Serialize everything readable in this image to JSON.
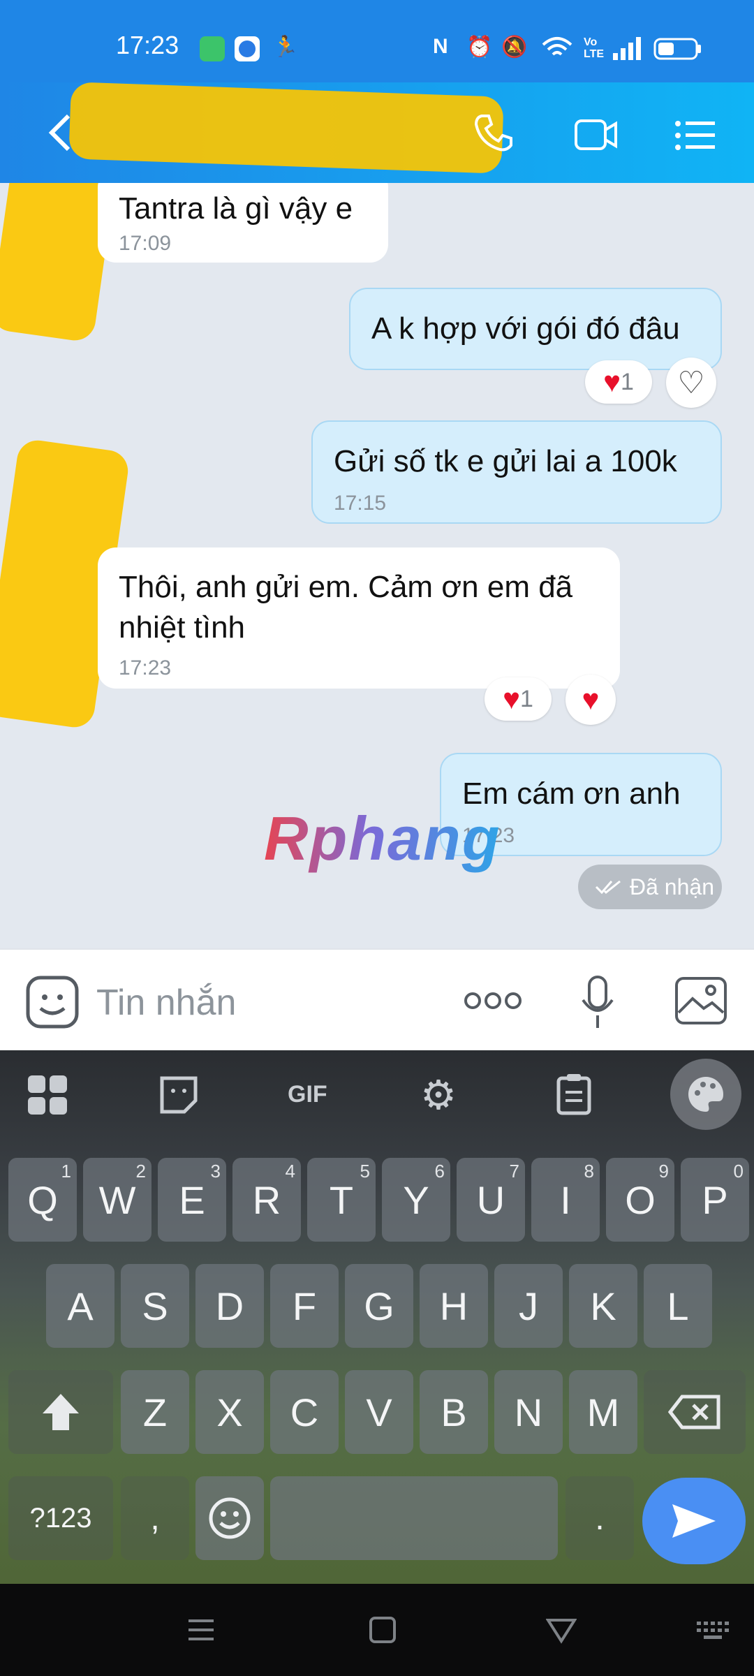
{
  "status_bar": {
    "time": "17:23",
    "icons": [
      "battery-saver-icon",
      "app-icon",
      "running-icon",
      "nfc-icon",
      "alarm-icon",
      "mute-icon",
      "wifi-icon",
      "volte-icon",
      "signal-icon",
      "battery-icon"
    ],
    "volte_label": "Vo LTE"
  },
  "header": {
    "icons": [
      "back-icon",
      "phone-icon",
      "video-call-icon",
      "menu-list-icon"
    ]
  },
  "messages": [
    {
      "direction": "in",
      "text": "Tantra là gì vậy e",
      "time": "17:09"
    },
    {
      "direction": "out",
      "text": "A k hợp với gói đó đâu",
      "reaction_count": "1"
    },
    {
      "direction": "out",
      "text": "Gửi số tk e gửi lai a 100k",
      "time": "17:15"
    },
    {
      "direction": "in",
      "text_line1": "Thôi, anh gửi em. Cảm ơn em đã",
      "text_line2": "nhiệt tình",
      "time": "17:23",
      "reaction_count": "1"
    },
    {
      "direction": "out",
      "text": "Em cám ơn anh",
      "time": "17:23"
    }
  ],
  "delivery_status": "Đã nhận",
  "watermark": "Rphang",
  "input": {
    "placeholder": "Tin nhắn"
  },
  "keyboard": {
    "toolbar": [
      "apps-grid-icon",
      "sticker-icon",
      "GIF",
      "settings-gear-icon",
      "clipboard-icon",
      "palette-icon"
    ],
    "gif_label": "GIF",
    "row1": [
      {
        "key": "Q",
        "hint": "1"
      },
      {
        "key": "W",
        "hint": "2"
      },
      {
        "key": "E",
        "hint": "3"
      },
      {
        "key": "R",
        "hint": "4"
      },
      {
        "key": "T",
        "hint": "5"
      },
      {
        "key": "Y",
        "hint": "6"
      },
      {
        "key": "U",
        "hint": "7"
      },
      {
        "key": "I",
        "hint": "8"
      },
      {
        "key": "O",
        "hint": "9"
      },
      {
        "key": "P",
        "hint": "0"
      }
    ],
    "row2": [
      "A",
      "S",
      "D",
      "F",
      "G",
      "H",
      "J",
      "K",
      "L"
    ],
    "row3": [
      "Z",
      "X",
      "C",
      "V",
      "B",
      "N",
      "M"
    ],
    "symbols_label": "?123",
    "comma": ",",
    "period": "."
  },
  "colors": {
    "header_start": "#1f86e6",
    "header_end": "#10b4f5",
    "outgoing_bubble": "#d5eefc",
    "incoming_bubble": "#ffffff",
    "send_button": "#4a8ff3",
    "redaction": "#fcc500"
  }
}
